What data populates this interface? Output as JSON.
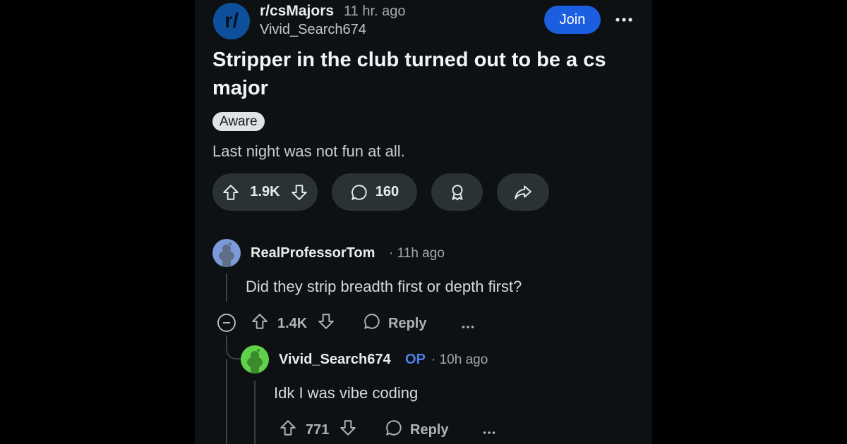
{
  "post": {
    "subreddit": "r/csMajors",
    "subreddit_icon_text": "r/",
    "time": "11 hr. ago",
    "author": "Vivid_Search674",
    "join_label": "Join",
    "title": "Stripper in the club turned out to be a cs major",
    "flair": "Aware",
    "body": "Last night was not fun at all.",
    "votes": "1.9K",
    "comments": "160"
  },
  "comments": [
    {
      "author": "RealProfessorTom",
      "time": "11h ago",
      "text": "Did they strip breadth first or depth first?",
      "votes": "1.4K",
      "reply_label": "Reply"
    },
    {
      "author": "Vivid_Search674",
      "op_badge": "OP",
      "time": "10h ago",
      "text": "Idk I was vibe coding",
      "votes": "771",
      "reply_label": "Reply"
    }
  ],
  "colors": {
    "background": "#000000",
    "panel": "#0e1113",
    "join": "#1b5ee0",
    "pill": "#2a3236",
    "op": "#4a80e8"
  },
  "icons": [
    "subreddit-icon",
    "more-icon",
    "upvote-icon",
    "downvote-icon",
    "comment-icon",
    "award-icon",
    "share-icon",
    "collapse-icon",
    "reply-icon",
    "snoo-avatar"
  ]
}
